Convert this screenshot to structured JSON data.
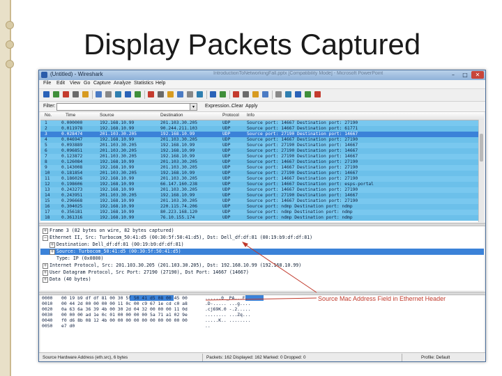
{
  "slide": {
    "title": "Display Packets Captured",
    "callout": "Source Mac Address Field in Ethernet Header"
  },
  "window": {
    "title": "(Untitled) - Wireshark",
    "background_title": "IntroductionToNetworkingFall.pptx [Compatibility Mode] - Microsoft PowerPoint",
    "min_glyph": "–",
    "max_glyph": "□",
    "close_glyph": "✕"
  },
  "menu": {
    "items": [
      "File",
      "Edit",
      "View",
      "Go",
      "Capture",
      "Analyze",
      "Statistics",
      "Help"
    ]
  },
  "toolbar": {
    "icons": [
      "list-interfaces-icon",
      "capture-options-icon",
      "start-capture-icon",
      "stop-capture-icon",
      "restart-capture-icon",
      "open-file-icon",
      "save-file-icon",
      "close-file-icon",
      "reload-icon",
      "print-icon",
      "find-packet-icon",
      "go-back-icon",
      "go-forward-icon",
      "go-to-packet-icon",
      "go-first-icon",
      "go-last-icon",
      "colorize-icon",
      "auto-scroll-icon",
      "zoom-in-icon",
      "zoom-out-icon",
      "normal-size-icon",
      "resize-columns-icon",
      "capture-filters-icon",
      "display-filters-icon",
      "coloring-rules-icon",
      "preferences-icon",
      "help-icon"
    ]
  },
  "filter": {
    "label": "Filter:",
    "value": "",
    "drop_glyph": "▾",
    "expression": "Expression...",
    "clear": "Clear",
    "apply": "Apply"
  },
  "packet_list": {
    "columns": [
      "No.",
      "Time",
      "Source",
      "Destination",
      "Protocol",
      "Info"
    ],
    "rows": [
      {
        "no": "1",
        "time": "0.000000",
        "src": "192.168.10.99",
        "dst": "201.103.30.205",
        "proto": "UDP",
        "info": "Source port: 14667  Destination port: 27190"
      },
      {
        "no": "2",
        "time": "0.011978",
        "src": "192.168.10.99",
        "dst": "90.244.211.103",
        "proto": "UDP",
        "info": "Source port: 14667  Destination port: 61771"
      },
      {
        "no": "3",
        "time": "0.028474",
        "src": "201.103.30.205",
        "dst": "192.168.10.99",
        "proto": "UDP",
        "info": "Source port: 27190  Destination port: 14667"
      },
      {
        "no": "4",
        "time": "0.046947",
        "src": "192.168.10.99",
        "dst": "201.103.30.205",
        "proto": "UDP",
        "info": "Source port: 14667  Destination port: 27190"
      },
      {
        "no": "5",
        "time": "0.093889",
        "src": "201.103.30.205",
        "dst": "192.168.10.99",
        "proto": "UDP",
        "info": "Source port: 27190  Destination port: 14667"
      },
      {
        "no": "6",
        "time": "0.096851",
        "src": "201.103.30.205",
        "dst": "192.168.10.99",
        "proto": "UDP",
        "info": "Source port: 27190  Destination port: 14667"
      },
      {
        "no": "7",
        "time": "0.123872",
        "src": "201.103.30.205",
        "dst": "192.168.10.99",
        "proto": "UDP",
        "info": "Source port: 27190  Destination port: 14667"
      },
      {
        "no": "8",
        "time": "0.126084",
        "src": "192.168.10.99",
        "dst": "201.103.30.205",
        "proto": "UDP",
        "info": "Source port: 14667  Destination port: 27190"
      },
      {
        "no": "9",
        "time": "0.143008",
        "src": "192.168.10.99",
        "dst": "201.103.30.205",
        "proto": "UDP",
        "info": "Source port: 14667  Destination port: 27190"
      },
      {
        "no": "10",
        "time": "0.181854",
        "src": "201.103.30.205",
        "dst": "192.168.10.99",
        "proto": "UDP",
        "info": "Source port: 27190  Destination port: 14667"
      },
      {
        "no": "11",
        "time": "0.186026",
        "src": "192.168.10.99",
        "dst": "201.103.30.205",
        "proto": "UDP",
        "info": "Source port: 14667  Destination port: 27190"
      },
      {
        "no": "12",
        "time": "0.198606",
        "src": "192.168.10.99",
        "dst": "66.147.160.238",
        "proto": "UDP",
        "info": "Source port: 14667  Destination port: esps-portal"
      },
      {
        "no": "13",
        "time": "0.243273",
        "src": "192.168.10.99",
        "dst": "201.103.30.205",
        "proto": "UDP",
        "info": "Source port: 14667  Destination port: 27190"
      },
      {
        "no": "14",
        "time": "0.243951",
        "src": "201.103.30.205",
        "dst": "192.168.10.99",
        "proto": "UDP",
        "info": "Source port: 27190  Destination port: 14667"
      },
      {
        "no": "15",
        "time": "0.296668",
        "src": "192.168.10.99",
        "dst": "201.103.30.205",
        "proto": "UDP",
        "info": "Source port: 14667  Destination port: 27190"
      },
      {
        "no": "16",
        "time": "0.304025",
        "src": "192.168.10.99",
        "dst": "220.115.74.206",
        "proto": "UDP",
        "info": "Source port: ndmp  Destination port: ndmp"
      },
      {
        "no": "17",
        "time": "0.356181",
        "src": "192.168.10.99",
        "dst": "80.223.168.120",
        "proto": "UDP",
        "info": "Source port: ndmp  Destination port: ndmp"
      },
      {
        "no": "18",
        "time": "0.361316",
        "src": "192.168.10.99",
        "dst": "76.10.155.174",
        "proto": "UDP",
        "info": "Source port: ndmp  Destination port: ndmp"
      }
    ]
  },
  "details": {
    "rows": [
      {
        "exp": "+",
        "text": "Frame 3 (82 bytes on wire, 82 bytes captured)"
      },
      {
        "exp": "−",
        "text": "Ethernet II, Src: Turbocom_50:41:d5 (00:30:5f:50:41:d5), Dst: Dell_df:df:81 (00:19:b9:df:df:81)"
      },
      {
        "exp": "+",
        "text": "Destination: Dell_df:df:81 (00:19:b9:df:df:81)"
      },
      {
        "exp": "+",
        "text": "Source: Turbocom_50:41:d5 (00:30:5f:50:41:d5)"
      },
      {
        "exp": "",
        "text": "Type: IP (0x0800)"
      },
      {
        "exp": "+",
        "text": "Internet Protocol, Src: 201.103.30.205 (201.103.30.205), Dst: 192.168.10.99 (192.168.10.99)"
      },
      {
        "exp": "+",
        "text": "User Datagram Protocol, Src Port: 27190 (27190), Dst Port: 14667 (14667)"
      },
      {
        "exp": "+",
        "text": "Data (40 bytes)"
      }
    ]
  },
  "hex": {
    "rows": [
      {
        "offset": "0000",
        "bytes": "00 19 b9 df df 81 00 30  5f 50 41 d5 08 00 45 00",
        "ascii": "......0 _PA...E."
      },
      {
        "offset": "0010",
        "bytes": "00 44 2d 00 00 00 00 11  0c 00 c9 67 1e cd c0 a8",
        "ascii": ".D-..... ...g...."
      },
      {
        "offset": "0020",
        "bytes": "0a 63 6a 36 39 4b 00 30  2d 04 32 00 00 00 11 0d",
        "ascii": ".cj69K.0 -.2....."
      },
      {
        "offset": "0030",
        "bytes": "00 00 00 ad 1e 0c 01 00  00 00 00 5a 71 a1 02 9e",
        "ascii": "........ ...Zq..."
      },
      {
        "offset": "0040",
        "bytes": "f0 d6 8b 08 12 4b 00 00  00 00 00 00 00 00 00 00",
        "ascii": ".....K.. ........"
      },
      {
        "offset": "0050",
        "bytes": "e7 d0",
        "ascii": ".."
      }
    ]
  },
  "status": {
    "field": "Source Hardware Address (eth.src), 6 bytes",
    "packets": "Packets: 162 Displayed: 162 Marked: 0 Dropped: 0",
    "profile": "Profile: Default"
  },
  "colors": {
    "row_even": "#79c8ef",
    "row_odd": "#6cc0ea",
    "selection": "#3b82d8",
    "callout": "#c0392b"
  }
}
